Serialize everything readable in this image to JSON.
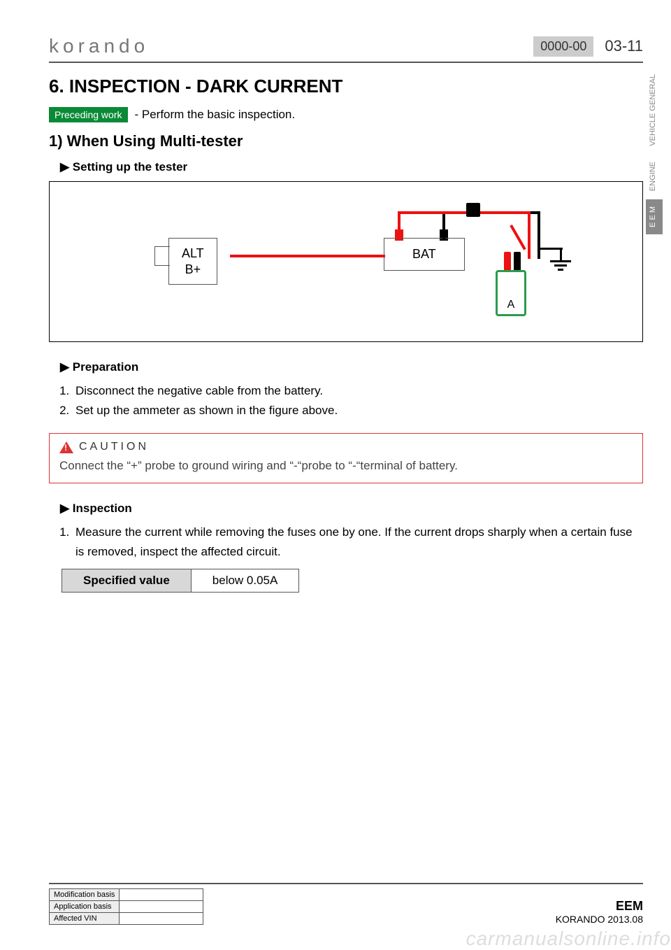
{
  "header": {
    "brand_text": "korando",
    "doc_code": "0000-00",
    "page_number": "03-11"
  },
  "side_tabs": {
    "items": [
      {
        "label": "VEHICLE\nGENERAL",
        "active": false
      },
      {
        "label": "ENGINE",
        "active": false
      },
      {
        "label": "E E M",
        "active": true
      }
    ]
  },
  "title": "6. INSPECTION - DARK CURRENT",
  "preceding": {
    "badge": "Preceding work",
    "text": "-  Perform the basic inspection."
  },
  "subtitle": "1) When Using Multi-tester",
  "setup_heading": "Setting up the tester",
  "figure": {
    "alt_line1": "ALT",
    "alt_line2": "B+",
    "bat": "BAT",
    "meter": "A"
  },
  "preparation": {
    "heading": "Preparation",
    "steps": [
      "Disconnect the negative cable from the battery.",
      "Set up the ammeter as shown in the figure above."
    ]
  },
  "caution": {
    "title": "CAUTION",
    "text": "Connect the “+” probe to ground wiring and “-“probe to “-“terminal of battery."
  },
  "inspection": {
    "heading": "Inspection",
    "steps": [
      "Measure the current while removing the fuses one by one. If the current drops sharply when a certain fuse is removed, inspect the affected circuit."
    ],
    "spec_label": "Specified value",
    "spec_value": "below 0.05A"
  },
  "footer": {
    "rows": [
      {
        "label": "Modification basis",
        "value": ""
      },
      {
        "label": "Application basis",
        "value": ""
      },
      {
        "label": "Affected VIN",
        "value": ""
      }
    ],
    "eem": "EEM",
    "doc_rev": "KORANDO 2013.08"
  },
  "watermark": "carmanualsonline.info"
}
